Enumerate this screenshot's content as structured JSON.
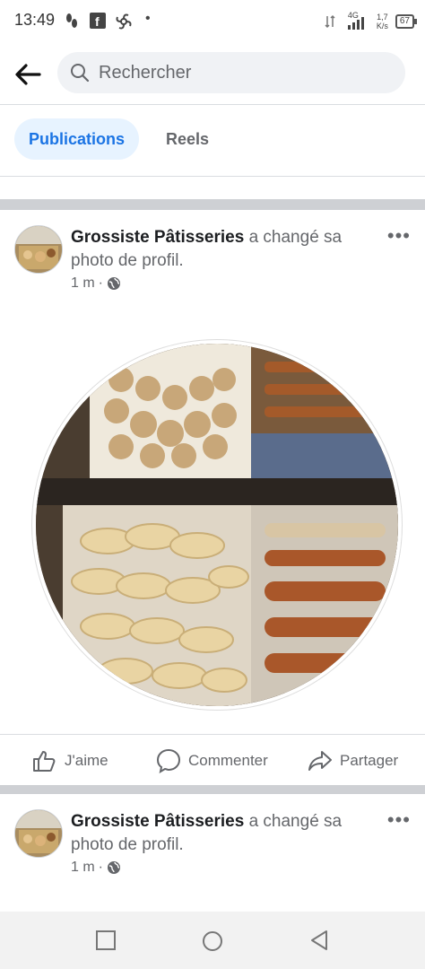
{
  "status_bar": {
    "time": "13:49",
    "network": "4G",
    "speed_value": "1,7",
    "speed_unit": "K/s",
    "battery": "67"
  },
  "search": {
    "placeholder": "Rechercher"
  },
  "tabs": [
    {
      "label": "Publications",
      "active": true
    },
    {
      "label": "Reels",
      "active": false
    }
  ],
  "posts": [
    {
      "author": "Grossiste Pâtisseries",
      "action": "a changé sa photo de profil.",
      "time": "1 m",
      "more": "•••"
    },
    {
      "author": "Grossiste Pâtisseries",
      "action": "a changé sa photo de profil.",
      "time": "1 m",
      "more": "•••"
    }
  ],
  "actions": {
    "like": "J'aime",
    "comment": "Commenter",
    "share": "Partager"
  },
  "icons": {
    "back": "arrow-left-icon",
    "search": "magnifier-icon",
    "privacy": "globe-icon",
    "like": "thumbs-up-icon",
    "comment": "speech-bubble-icon",
    "share": "share-arrow-icon"
  },
  "colors": {
    "accent": "#1b74e4",
    "tab_active_bg": "#e7f3ff",
    "separator": "#ced0d4"
  }
}
